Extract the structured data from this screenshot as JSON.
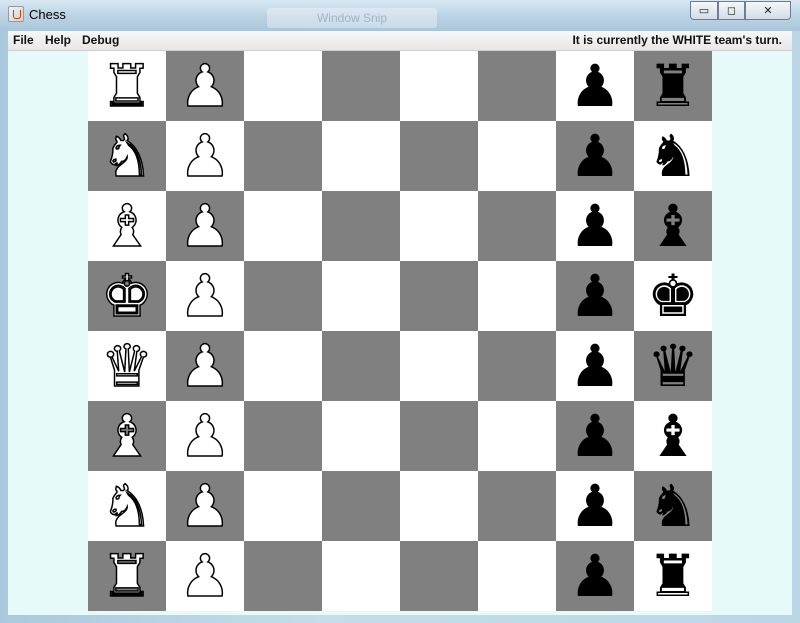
{
  "window": {
    "title": "Chess",
    "ghost_label": "Window Snip",
    "controls": {
      "minimize": "▭",
      "maximize": "◻",
      "close": "✕"
    }
  },
  "menu": {
    "items": [
      "File",
      "Help",
      "Debug"
    ],
    "status": "It is currently the WHITE team's turn."
  },
  "board": {
    "colors": {
      "light": "#ffffff",
      "dark": "#808080"
    },
    "rows": [
      [
        {
          "p": "♜",
          "c": "w",
          "icon": "white-rook-icon"
        },
        {
          "p": "♟",
          "c": "w",
          "icon": "white-pawn-icon"
        },
        null,
        null,
        null,
        null,
        {
          "p": "♟",
          "c": "b",
          "icon": "black-pawn-icon"
        },
        {
          "p": "♜",
          "c": "b",
          "icon": "black-rook-icon"
        }
      ],
      [
        {
          "p": "♞",
          "c": "w",
          "icon": "white-knight-icon"
        },
        {
          "p": "♟",
          "c": "w",
          "icon": "white-pawn-icon"
        },
        null,
        null,
        null,
        null,
        {
          "p": "♟",
          "c": "b",
          "icon": "black-pawn-icon"
        },
        {
          "p": "♞",
          "c": "b",
          "icon": "black-knight-icon"
        }
      ],
      [
        {
          "p": "♝",
          "c": "w",
          "icon": "white-bishop-icon"
        },
        {
          "p": "♟",
          "c": "w",
          "icon": "white-pawn-icon"
        },
        null,
        null,
        null,
        null,
        {
          "p": "♟",
          "c": "b",
          "icon": "black-pawn-icon"
        },
        {
          "p": "♝",
          "c": "b",
          "icon": "black-bishop-icon"
        }
      ],
      [
        {
          "p": "♚",
          "c": "w",
          "icon": "white-king-icon"
        },
        {
          "p": "♟",
          "c": "w",
          "icon": "white-pawn-icon"
        },
        null,
        null,
        null,
        null,
        {
          "p": "♟",
          "c": "b",
          "icon": "black-pawn-icon"
        },
        {
          "p": "♚",
          "c": "b",
          "icon": "black-king-icon"
        }
      ],
      [
        {
          "p": "♛",
          "c": "w",
          "icon": "white-queen-icon"
        },
        {
          "p": "♟",
          "c": "w",
          "icon": "white-pawn-icon"
        },
        null,
        null,
        null,
        null,
        {
          "p": "♟",
          "c": "b",
          "icon": "black-pawn-icon"
        },
        {
          "p": "♛",
          "c": "b",
          "icon": "black-queen-icon"
        }
      ],
      [
        {
          "p": "♝",
          "c": "w",
          "icon": "white-bishop-icon"
        },
        {
          "p": "♟",
          "c": "w",
          "icon": "white-pawn-icon"
        },
        null,
        null,
        null,
        null,
        {
          "p": "♟",
          "c": "b",
          "icon": "black-pawn-icon"
        },
        {
          "p": "♝",
          "c": "b",
          "icon": "black-bishop-icon"
        }
      ],
      [
        {
          "p": "♞",
          "c": "w",
          "icon": "white-knight-icon"
        },
        {
          "p": "♟",
          "c": "w",
          "icon": "white-pawn-icon"
        },
        null,
        null,
        null,
        null,
        {
          "p": "♟",
          "c": "b",
          "icon": "black-pawn-icon"
        },
        {
          "p": "♞",
          "c": "b",
          "icon": "black-knight-icon"
        }
      ],
      [
        {
          "p": "♜",
          "c": "w",
          "icon": "white-rook-icon"
        },
        {
          "p": "♟",
          "c": "w",
          "icon": "white-pawn-icon"
        },
        null,
        null,
        null,
        null,
        {
          "p": "♟",
          "c": "b",
          "icon": "black-pawn-icon"
        },
        {
          "p": "♜",
          "c": "b",
          "icon": "black-rook-icon"
        }
      ]
    ]
  }
}
